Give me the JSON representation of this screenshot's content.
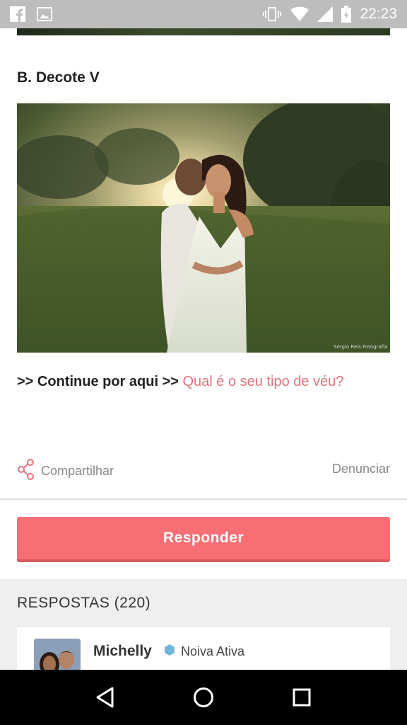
{
  "status_bar": {
    "time": "22:23",
    "icons": [
      "facebook-icon",
      "image-icon",
      "vibrate-icon",
      "wifi-icon",
      "signal-icon",
      "battery-icon"
    ]
  },
  "post": {
    "section_title": "B. Decote V",
    "continue_prefix": ">> Continue por aqui >> ",
    "continue_link": "Qual é o seu tipo de véu?",
    "share_label": "Compartilhar",
    "report_label": "Denunciar"
  },
  "respond_button": "Responder",
  "answers": {
    "title": "RESPOSTAS (220)",
    "first": {
      "name": "Michelly",
      "badge": "Noiva Ativa"
    }
  },
  "colors": {
    "accent": "#f56f74",
    "link": "#e2737a",
    "badge": "#6fb6d9"
  }
}
